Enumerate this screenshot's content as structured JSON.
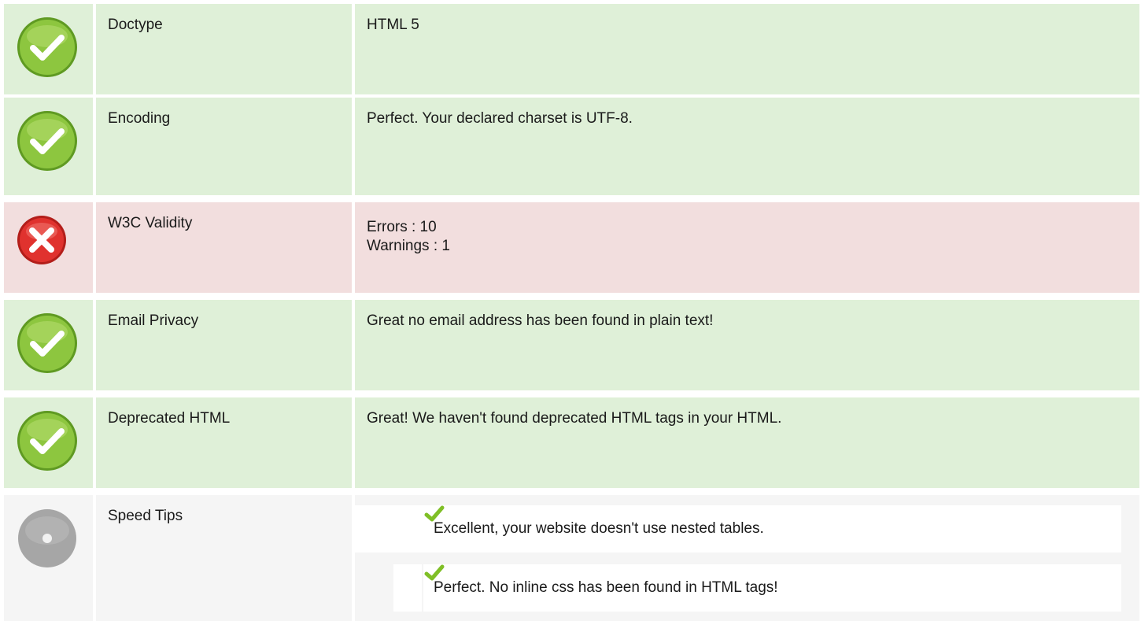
{
  "rows": [
    {
      "status": "pass",
      "icon": "check-circle-icon",
      "label": "Doctype",
      "value_lines": [
        "HTML 5"
      ]
    },
    {
      "status": "pass",
      "icon": "check-circle-icon",
      "label": "Encoding",
      "value_lines": [
        "Perfect. Your declared charset is UTF-8."
      ]
    },
    {
      "status": "fail",
      "icon": "error-circle-icon",
      "label": "W3C Validity",
      "value_lines": [
        "Errors : 10",
        "Warnings : 1"
      ]
    },
    {
      "status": "pass",
      "icon": "check-circle-icon",
      "label": "Email Privacy",
      "value_lines": [
        "Great no email address has been found in plain text!"
      ]
    },
    {
      "status": "pass",
      "icon": "check-circle-icon",
      "label": "Deprecated HTML",
      "value_lines": [
        "Great! We haven't found deprecated HTML tags in your HTML."
      ]
    },
    {
      "status": "info",
      "icon": "info-circle-icon",
      "label": "Speed Tips"
    }
  ],
  "speed_tips": [
    {
      "icon": "check-mark-icon",
      "text": "Excellent, your website doesn't use nested tables."
    },
    {
      "icon": "check-mark-icon",
      "text": "Perfect. No inline css has been found in HTML tags!"
    }
  ],
  "colors": {
    "pass_bg": "#dff0d8",
    "fail_bg": "#f2dede",
    "neutral_bg": "#f5f5f5",
    "pass_icon": "#8dc63f",
    "fail_icon": "#e0322e",
    "neutral_icon": "#a6a6a6"
  }
}
